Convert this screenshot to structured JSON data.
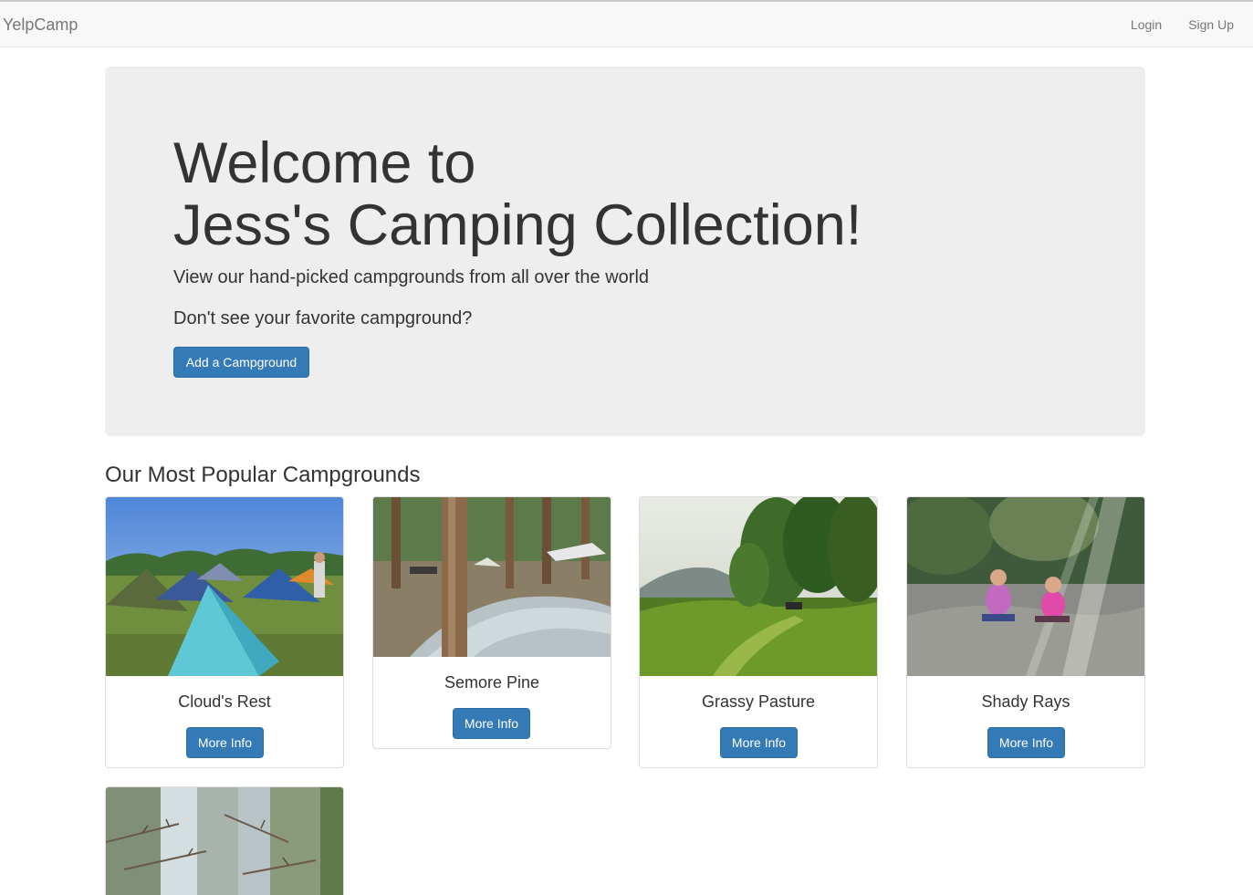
{
  "navbar": {
    "brand": "YelpCamp",
    "links": [
      {
        "label": "Login"
      },
      {
        "label": "Sign Up"
      }
    ]
  },
  "jumbotron": {
    "title_line1": "Welcome to",
    "title_line2": "Jess's Camping Collection!",
    "lead": "View our hand-picked campgrounds from all over the world",
    "prompt": "Don't see your favorite campground?",
    "button_label": "Add a Campground"
  },
  "section": {
    "title": "Our Most Popular Campgrounds"
  },
  "campgrounds": [
    {
      "name": "Cloud's Rest",
      "button_label": "More Info"
    },
    {
      "name": "Semore Pine",
      "button_label": "More Info"
    },
    {
      "name": "Grassy Pasture",
      "button_label": "More Info"
    },
    {
      "name": "Shady Rays",
      "button_label": "More Info"
    }
  ],
  "colors": {
    "primary": "#337ab7",
    "navbar_bg": "#f8f8f8",
    "jumbotron_bg": "#eeeeee"
  }
}
